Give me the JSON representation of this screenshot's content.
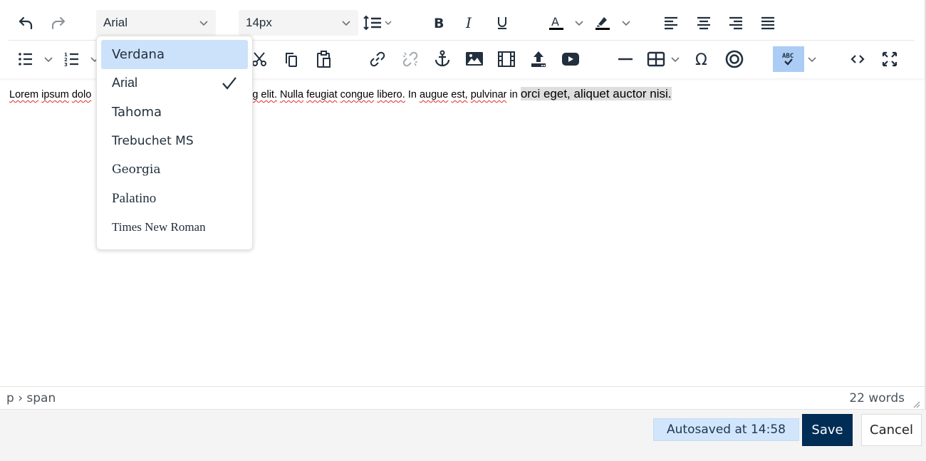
{
  "toolbar": {
    "font_family_value": "Arial",
    "font_size_value": "14px",
    "row1_icons": [
      "undo-icon",
      "redo-icon",
      "line-height-icon",
      "bold-icon",
      "italic-icon",
      "underline-icon",
      "text-color-icon",
      "highlight-color-icon",
      "align-left-icon",
      "align-center-icon",
      "align-right-icon",
      "justify-icon"
    ],
    "row2_icons": [
      "bullet-list-icon",
      "numbered-list-icon",
      "cut-icon",
      "copy-icon",
      "paste-icon",
      "link-icon",
      "unlink-icon",
      "anchor-icon",
      "image-icon",
      "media-icon",
      "upload-icon",
      "youtube-icon",
      "horizontal-line-icon",
      "table-icon",
      "special-character-icon",
      "accessibility-icon",
      "spellcheck-icon",
      "source-code-icon",
      "fullscreen-icon"
    ],
    "spellcheck_active": true
  },
  "font_dropdown": {
    "items": [
      {
        "label": "Verdana",
        "highlighted": true,
        "selected": false
      },
      {
        "label": "Arial",
        "highlighted": false,
        "selected": true
      },
      {
        "label": "Tahoma",
        "highlighted": false,
        "selected": false
      },
      {
        "label": "Trebuchet MS",
        "highlighted": false,
        "selected": false
      },
      {
        "label": "Georgia",
        "highlighted": false,
        "selected": false
      },
      {
        "label": "Palatino",
        "highlighted": false,
        "selected": false
      },
      {
        "label": "Times New Roman",
        "highlighted": false,
        "selected": false
      }
    ]
  },
  "content": {
    "w1": "Lorem",
    "w2": "ipsum",
    "w3": "dolo",
    "w4": "g elit.",
    "w5": "Nulla",
    "w6": "feugiat",
    "w7": "congue",
    "w8": "libero.",
    "w9": "In",
    "w10": "augue",
    "w11": "est,",
    "w12": "pulvinar",
    "w13": "in",
    "highlighted": "orci eget, aliquet auctor nisi."
  },
  "statusbar": {
    "path": "p › span",
    "word_count": "22 words"
  },
  "footer": {
    "autosave": "Autosaved at 14:58",
    "save_label": "Save",
    "cancel_label": "Cancel"
  },
  "colors": {
    "primary": "#002d56",
    "autosave_bg": "#d1e6fa",
    "dropdown_highlight": "#cce2fa",
    "spellcheck_active": "#abcdf5",
    "icon": "#222f3e"
  }
}
